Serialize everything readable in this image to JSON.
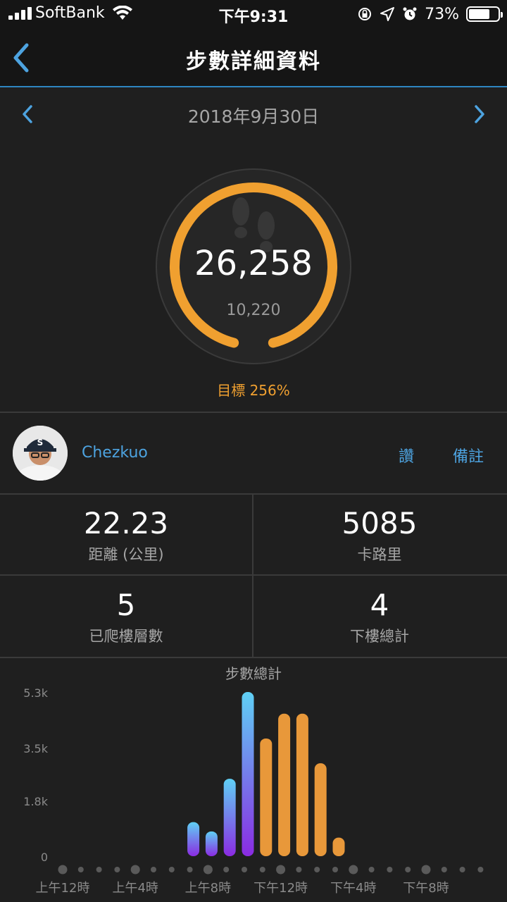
{
  "status_bar": {
    "carrier": "SoftBank",
    "time": "下午9:31",
    "battery": "73%",
    "battery_level": 0.73
  },
  "nav": {
    "title": "步數詳細資料"
  },
  "date": {
    "text": "2018年9月30日"
  },
  "ring": {
    "steps": "26,258",
    "goal_steps": "10,220",
    "progress": 0.92
  },
  "goal_text": "目標 256%",
  "user": {
    "name": "Chezkuo",
    "like_label": "讚",
    "note_label": "備註"
  },
  "stats": [
    {
      "value": "22.23",
      "label": "距離 (公里)"
    },
    {
      "value": "5085",
      "label": "卡路里"
    },
    {
      "value": "5",
      "label": "已爬樓層數"
    },
    {
      "value": "4",
      "label": "下樓總計"
    }
  ],
  "colors": {
    "accent": "#f0a030",
    "link": "#4da3e0",
    "bar_blue_top": "#5fd0f5",
    "bar_purple_bottom": "#8a2be2",
    "bar_orange": "#e8983a"
  },
  "chart_data": {
    "type": "bar",
    "title": "步數總計",
    "ytick_labels": [
      "5.3k",
      "3.5k",
      "1.8k",
      "0"
    ],
    "ylim": [
      0,
      5300
    ],
    "xtick_labels": [
      "上午12時",
      "上午4時",
      "上午8時",
      "下午12時",
      "下午4時",
      "下午8時"
    ],
    "slots": 24,
    "bars": [
      {
        "hour": 7,
        "value": 1100,
        "goal_reached": false
      },
      {
        "hour": 8,
        "value": 800,
        "goal_reached": false
      },
      {
        "hour": 9,
        "value": 2500,
        "goal_reached": false
      },
      {
        "hour": 10,
        "value": 5300,
        "goal_reached": false
      },
      {
        "hour": 11,
        "value": 3800,
        "goal_reached": true
      },
      {
        "hour": 12,
        "value": 4600,
        "goal_reached": true
      },
      {
        "hour": 13,
        "value": 4600,
        "goal_reached": true
      },
      {
        "hour": 14,
        "value": 3000,
        "goal_reached": true
      },
      {
        "hour": 15,
        "value": 600,
        "goal_reached": true
      }
    ]
  }
}
